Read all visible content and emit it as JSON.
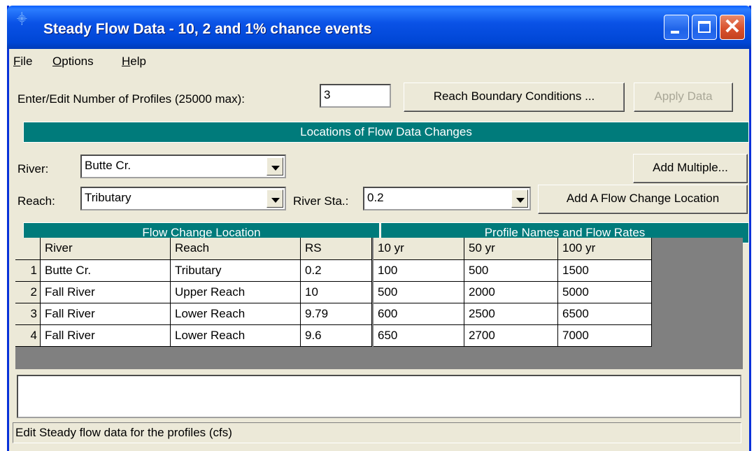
{
  "window": {
    "title": "Steady Flow Data - 10, 2 and 1% chance events",
    "close_glyph": "✕"
  },
  "menu": {
    "file": "File",
    "options": "Options",
    "help": "Help"
  },
  "profiles": {
    "label": "Enter/Edit Number of Profiles (25000 max):",
    "value": "3"
  },
  "buttons": {
    "reach_bc": "Reach Boundary Conditions ...",
    "apply": "Apply Data",
    "add_multiple": "Add Multiple...",
    "add_location": "Add A Flow Change Location"
  },
  "locations_header": "Locations of Flow Data Changes",
  "selectors": {
    "river_label": "River:",
    "river_value": "Butte Cr.",
    "reach_label": "Reach:",
    "reach_value": "Tributary",
    "station_label": "River Sta.:",
    "station_value": "0.2"
  },
  "grid": {
    "group_left": "Flow Change Location",
    "group_right": "Profile Names and Flow Rates",
    "columns": [
      "River",
      "Reach",
      "RS",
      "10 yr",
      "50 yr",
      "100 yr"
    ],
    "rows": [
      {
        "n": "1",
        "river": "Butte Cr.",
        "reach": "Tributary",
        "rs": "0.2",
        "p1": "100",
        "p2": "500",
        "p3": "1500"
      },
      {
        "n": "2",
        "river": "Fall River",
        "reach": "Upper Reach",
        "rs": "10",
        "p1": "500",
        "p2": "2000",
        "p3": "5000"
      },
      {
        "n": "3",
        "river": "Fall River",
        "reach": "Lower Reach",
        "rs": "9.79",
        "p1": "600",
        "p2": "2500",
        "p3": "6500"
      },
      {
        "n": "4",
        "river": "Fall River",
        "reach": "Lower Reach",
        "rs": "9.6",
        "p1": "650",
        "p2": "2700",
        "p3": "7000"
      }
    ]
  },
  "status": "Edit Steady flow data for the profiles (cfs)",
  "colors": {
    "teal_header": "#007b7b",
    "title_blue": "#0046d5",
    "close_red": "#d9512d"
  },
  "icons": {
    "app": "app-icon",
    "minimize": "minimize-icon",
    "maximize": "maximize-icon",
    "close": "close-icon",
    "dropdown": "chevron-down-icon"
  }
}
